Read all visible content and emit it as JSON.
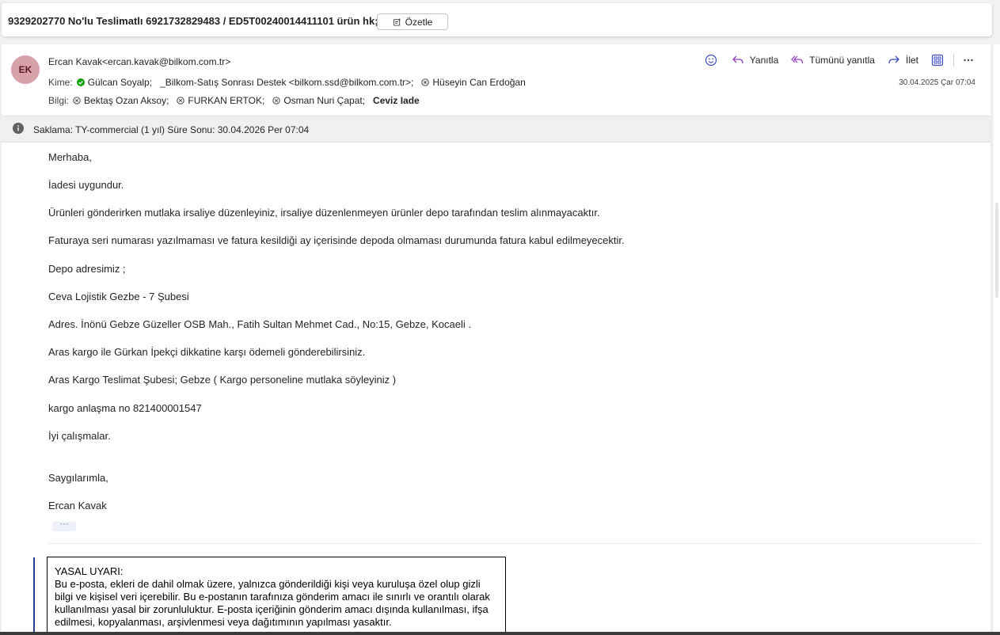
{
  "subject": {
    "title": "9329202770 No'lu Teslimatlı 6921732829483 / ED5T00240014411101 ürün hk;",
    "summarize_label": "Özetle"
  },
  "message": {
    "avatar_initials": "EK",
    "from": "Ercan Kavak<ercan.kavak@bilkom.com.tr>",
    "to_label": "Kime:",
    "to": [
      "Gülcan Soyalp;",
      "_Bilkom-Satış Sonrası Destek <bilkom.ssd@bilkom.com.tr>;",
      "Hüseyin Can Erdoğan"
    ],
    "cc_label": "Bilgi:",
    "cc": [
      "Bektaş Ozan Aksoy;",
      "FURKAN ERTOK;",
      "Osman Nuri Çapat;",
      "Ceviz Iade"
    ],
    "date": "30.04.2025 Çar 07:04",
    "actions": {
      "reply": "Yanıtla",
      "reply_all": "Tümünü yanıtla",
      "forward": "İlet"
    },
    "retention": "Saklama: TY-commercial (1 yıl) Süre Sonu: 30.04.2026 Per 07:04",
    "body": [
      "Merhaba,",
      "İadesi uygundur.",
      "Ürünleri gönderirken mutlaka irsaliye düzenleyiniz, irsaliye düzenlenmeyen ürünler depo tarafından teslim alınmayacaktır.",
      "Faturaya seri numarası yazılmaması ve fatura kesildiği ay içerisinde depoda olmaması durumunda fatura kabul edilmeyecektir.",
      "Depo adresimiz ;",
      "Ceva Lojistik Gezbe - 7 Şubesi",
      "Adres. İnönü Gebze Güzeller OSB Mah., Fatih Sultan Mehmet Cad., No:15, Gebze, Kocaeli .",
      "Aras kargo ile Gürkan İpekçi dikkatine karşı ödemeli gönderebilirsiniz.",
      "Aras Kargo Teslimat Şubesi; Gebze ( Kargo personeline mutlaka söyleyiniz )",
      "kargo anlaşma no 821400001547",
      "İyi çalışmalar.",
      "Saygılarımla,",
      "Ercan Kavak"
    ],
    "legal": {
      "title": "YASAL UYARI:",
      "text": "Bu e-posta, ekleri de dahil olmak üzere, yalnızca gönderildiği kişi veya kuruluşa özel olup gizli bilgi ve kişisel veri içerebilir. Bu e-postanın tarafınıza gönderim amacı ile sınırlı ve orantılı olarak kullanılması yasal bir zorunluluktur. E-posta içeriğinin gönderim amacı dışında kullanılması, ifşa edilmesi, kopyalanması, arşivlenmesi veya dağıtımının yapılması yasaktır."
    }
  },
  "colors": {
    "accent_purple": "#8a3fb8",
    "accent_blue": "#3b4cc0",
    "status_green": "#13a10e",
    "avatar_bg": "#d9a1a8"
  }
}
